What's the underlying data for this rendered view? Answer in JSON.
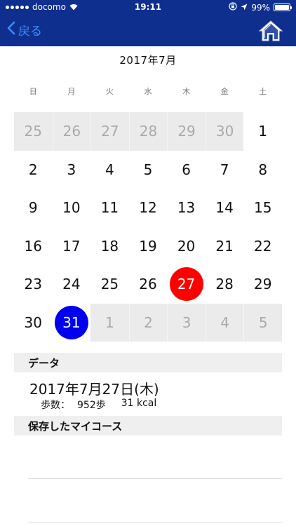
{
  "status_bar": {
    "carrier": "docomo",
    "time": "19:11",
    "battery": "99%",
    "battery_level": 0.99
  },
  "nav": {
    "back_label": "戻る",
    "back_icon": "chevron-left-icon",
    "home_icon": "home-icon"
  },
  "calendar": {
    "month_title": "2017年7月",
    "weekdays": [
      "日",
      "月",
      "火",
      "水",
      "木",
      "金",
      "土"
    ],
    "weeks": [
      [
        {
          "d": "25",
          "o": true
        },
        {
          "d": "26",
          "o": true
        },
        {
          "d": "27",
          "o": true
        },
        {
          "d": "28",
          "o": true
        },
        {
          "d": "29",
          "o": true
        },
        {
          "d": "30",
          "o": true
        },
        {
          "d": "1"
        }
      ],
      [
        {
          "d": "2"
        },
        {
          "d": "3"
        },
        {
          "d": "4"
        },
        {
          "d": "5"
        },
        {
          "d": "6"
        },
        {
          "d": "7"
        },
        {
          "d": "8"
        }
      ],
      [
        {
          "d": "9"
        },
        {
          "d": "10"
        },
        {
          "d": "11"
        },
        {
          "d": "12"
        },
        {
          "d": "13"
        },
        {
          "d": "14"
        },
        {
          "d": "15"
        }
      ],
      [
        {
          "d": "16"
        },
        {
          "d": "17"
        },
        {
          "d": "18"
        },
        {
          "d": "19"
        },
        {
          "d": "20"
        },
        {
          "d": "21"
        },
        {
          "d": "22"
        }
      ],
      [
        {
          "d": "23"
        },
        {
          "d": "24"
        },
        {
          "d": "25"
        },
        {
          "d": "26"
        },
        {
          "d": "27",
          "mark": "red"
        },
        {
          "d": "28"
        },
        {
          "d": "29"
        }
      ],
      [
        {
          "d": "30"
        },
        {
          "d": "31",
          "mark": "blue"
        },
        {
          "d": "1",
          "o": true
        },
        {
          "d": "2",
          "o": true
        },
        {
          "d": "3",
          "o": true
        },
        {
          "d": "4",
          "o": true
        },
        {
          "d": "5",
          "o": true
        }
      ]
    ]
  },
  "data_section": {
    "header": "データ",
    "date": "2017年7月27日(木)",
    "steps_label": "歩数：",
    "steps_value": "952歩",
    "calories": "31 kcal"
  },
  "courses_section": {
    "header": "保存したマイコース"
  },
  "colors": {
    "nav_background": "#0f2f8f",
    "accent_blue": "#3b8cff",
    "selected_red": "#ff0000",
    "today_blue": "#0000ee"
  }
}
